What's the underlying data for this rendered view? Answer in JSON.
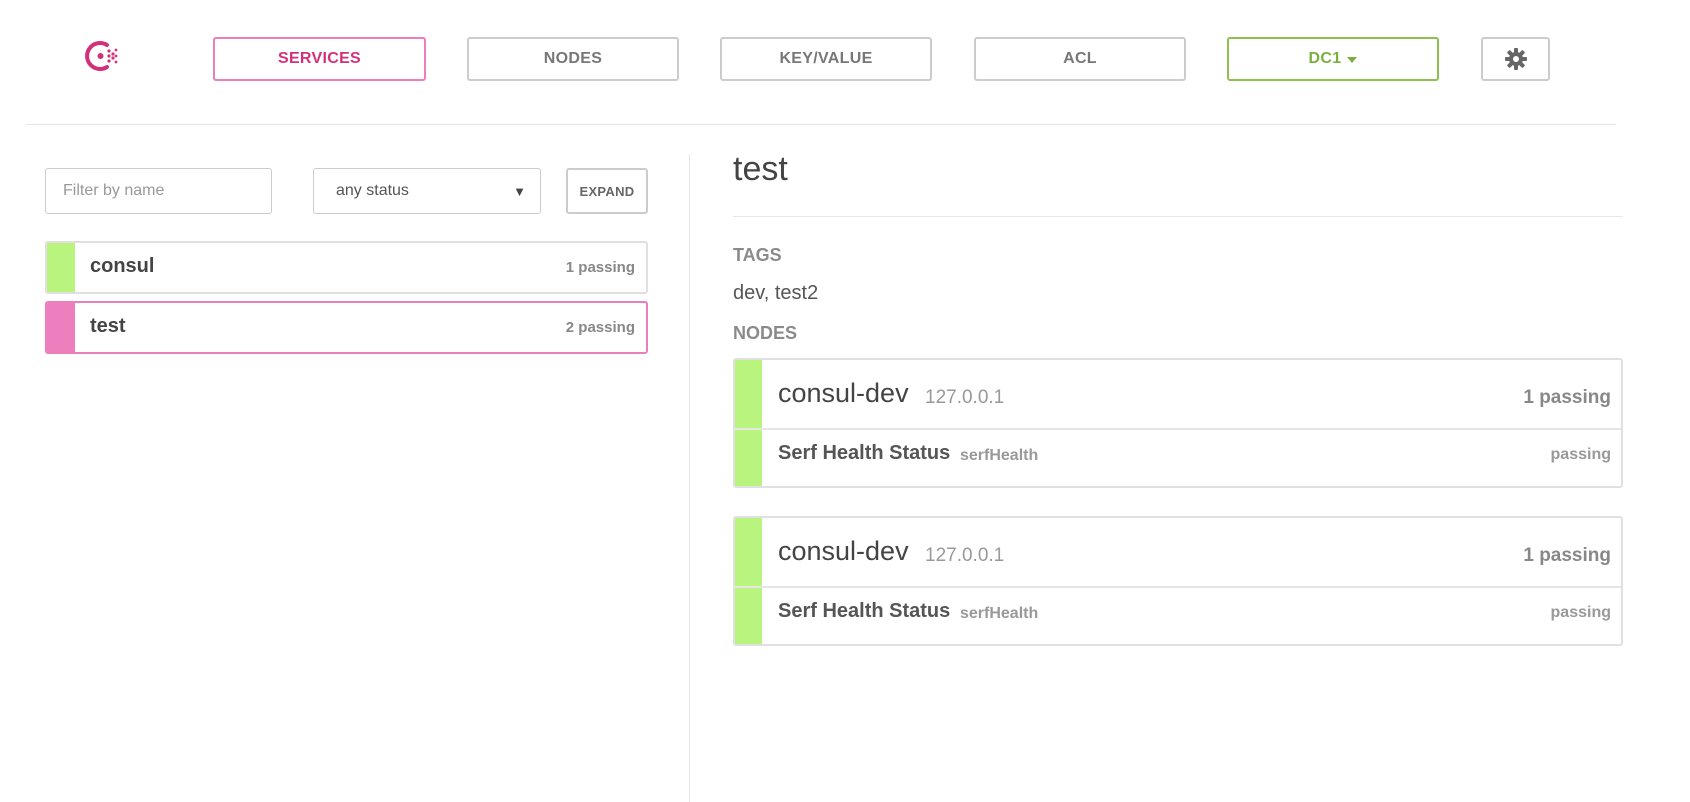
{
  "colors": {
    "accent": "#d2317a",
    "passing": "#b9f47e",
    "selected_bar": "#ec7fbe",
    "dc_green": "#7ab040"
  },
  "nav": {
    "logo_icon": "consul-logo-icon",
    "services": "SERVICES",
    "nodes": "NODES",
    "key_value": "KEY/VALUE",
    "acl": "ACL",
    "datacenter": "DC1",
    "settings_icon": "gear-icon"
  },
  "sidebar": {
    "filter_placeholder": "Filter by name",
    "filter_value": "",
    "status_select": "any status",
    "expand_label": "EXPAND",
    "services": [
      {
        "name": "consul",
        "count": "1 passing",
        "selected": false
      },
      {
        "name": "test",
        "count": "2 passing",
        "selected": true
      }
    ]
  },
  "detail": {
    "title": "test",
    "tags_label": "TAGS",
    "tags": "dev, test2",
    "nodes_label": "NODES",
    "nodes": [
      {
        "name": "consul-dev",
        "address": "127.0.0.1",
        "count": "1 passing",
        "check": {
          "name": "Serf Health Status",
          "id": "serfHealth",
          "status": "passing"
        }
      },
      {
        "name": "consul-dev",
        "address": "127.0.0.1",
        "count": "1 passing",
        "check": {
          "name": "Serf Health Status",
          "id": "serfHealth",
          "status": "passing"
        }
      }
    ]
  }
}
